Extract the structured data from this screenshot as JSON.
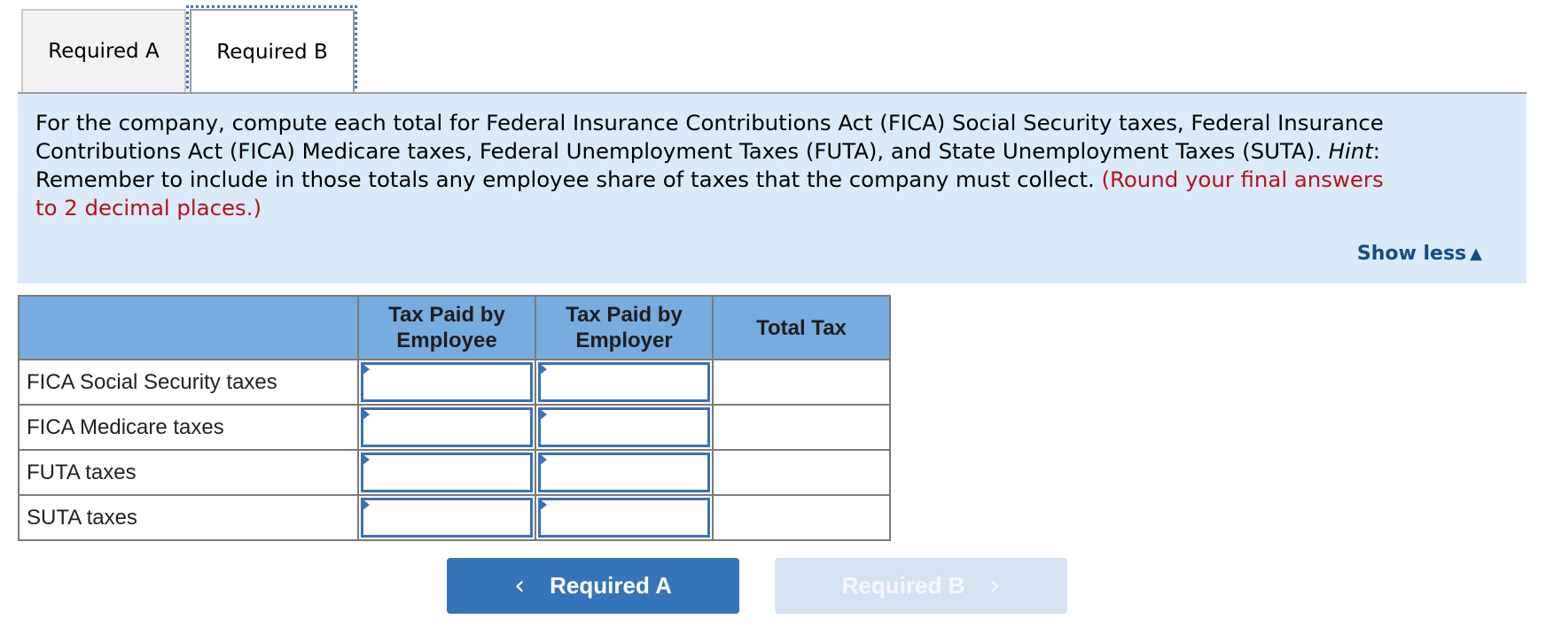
{
  "tabs": [
    {
      "label": "Required A",
      "active": false
    },
    {
      "label": "Required B",
      "active": true
    }
  ],
  "instructions": {
    "line1": "For the company, compute each total for Federal Insurance Contributions Act (FICA) Social Security taxes, Federal Insurance",
    "line2_a": "Contributions Act (FICA) Medicare taxes, Federal Unemployment Taxes (FUTA), and State Unemployment Taxes (SUTA). ",
    "line2_hint": "Hint",
    "line2_b": ":",
    "line3_a": "Remember to include in those totals any employee share of taxes that the company must collect. ",
    "line3_red": "(Round your final answers",
    "line4_red": "to 2 decimal places.)",
    "show_less": "Show less",
    "show_less_icon": "▲"
  },
  "table": {
    "headers": [
      "",
      "Tax Paid by Employee",
      "Tax Paid by Employer",
      "Total Tax"
    ],
    "header_lines": [
      [
        "Tax Paid by",
        "Employee"
      ],
      [
        "Tax Paid by",
        "Employer"
      ],
      [
        "Total Tax"
      ]
    ],
    "rows": [
      {
        "label": "FICA Social Security taxes",
        "employee": "",
        "employer": "",
        "total": ""
      },
      {
        "label": "FICA Medicare taxes",
        "employee": "",
        "employer": "",
        "total": ""
      },
      {
        "label": "FUTA taxes",
        "employee": "",
        "employer": "",
        "total": ""
      },
      {
        "label": "SUTA taxes",
        "employee": "",
        "employer": "",
        "total": ""
      }
    ]
  },
  "nav": {
    "prev_label": "Required A",
    "prev_icon": "‹",
    "next_label": "Required B",
    "next_icon": "›"
  },
  "colors": {
    "accent": "#3674b9",
    "panel_bg": "#daeaf8",
    "header_bg": "#77acdf",
    "warning_red": "#b5121b",
    "link": "#164b87"
  }
}
